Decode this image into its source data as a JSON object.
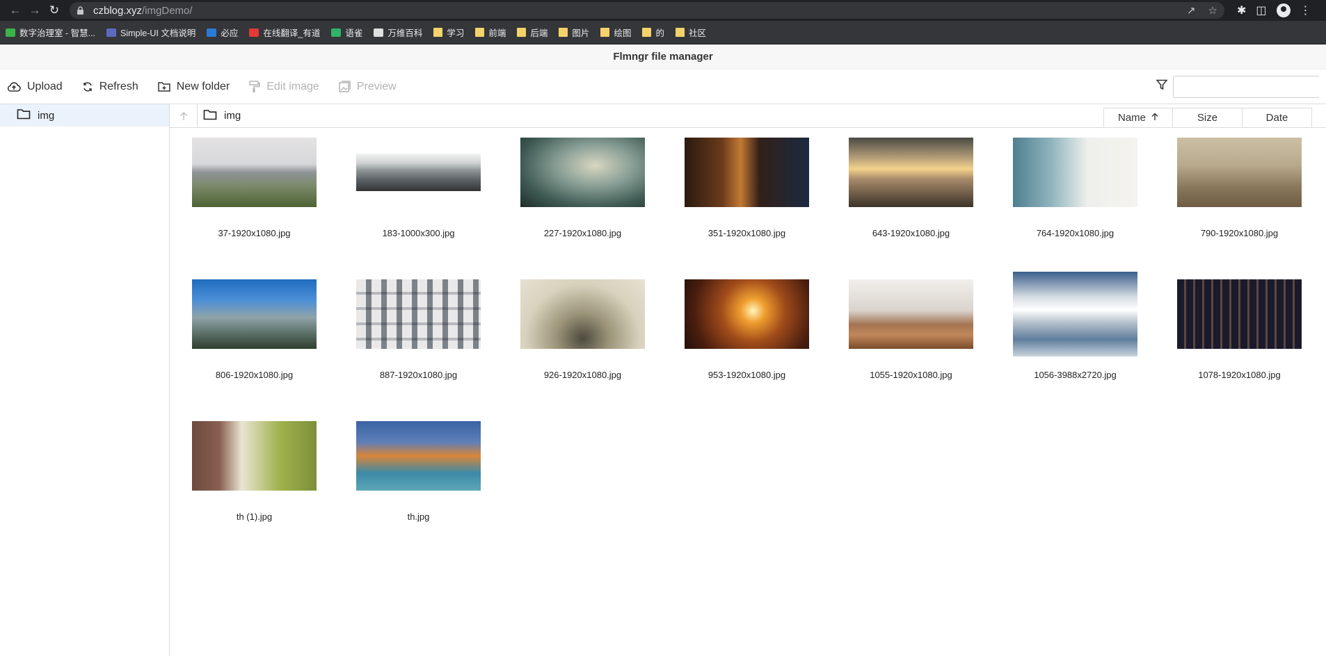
{
  "browser": {
    "url_host": "czblog.xyz",
    "url_path": "/imgDemo/",
    "bookmarks": [
      {
        "label": "数字治理室 - 智慧...",
        "color": "#3bb24a",
        "folder": false
      },
      {
        "label": "Simple-UI 文档说明",
        "color": "#5c6bc0",
        "folder": false
      },
      {
        "label": "必应",
        "color": "#2b7bd6",
        "folder": false
      },
      {
        "label": "在线翻译_有道",
        "color": "#e53935",
        "folder": false
      },
      {
        "label": "语雀",
        "color": "#2fb36a",
        "folder": false
      },
      {
        "label": "万维百科",
        "color": "#e0e0e0",
        "folder": false
      },
      {
        "label": "学习",
        "folder": true
      },
      {
        "label": "前端",
        "folder": true
      },
      {
        "label": "后端",
        "folder": true
      },
      {
        "label": "图片",
        "folder": true
      },
      {
        "label": "绘图",
        "folder": true
      },
      {
        "label": "的",
        "folder": true
      },
      {
        "label": "社区",
        "folder": true
      }
    ]
  },
  "app": {
    "title": "Flmngr file manager",
    "toolbar": {
      "upload": "Upload",
      "refresh": "Refresh",
      "new_folder": "New folder",
      "edit_image": "Edit image",
      "preview": "Preview"
    },
    "search": {
      "placeholder": ""
    },
    "sidebar": {
      "folder": "img"
    },
    "path": {
      "current": "img"
    },
    "sort": {
      "name": "Name",
      "size": "Size",
      "date": "Date"
    },
    "files": [
      {
        "name": "37-1920x1080.jpg",
        "thumb": "t0",
        "shape": "normal"
      },
      {
        "name": "183-1000x300.jpg",
        "thumb": "t1",
        "shape": "wide"
      },
      {
        "name": "227-1920x1080.jpg",
        "thumb": "t2",
        "shape": "normal"
      },
      {
        "name": "351-1920x1080.jpg",
        "thumb": "t3",
        "shape": "normal"
      },
      {
        "name": "643-1920x1080.jpg",
        "thumb": "t4",
        "shape": "normal"
      },
      {
        "name": "764-1920x1080.jpg",
        "thumb": "t5",
        "shape": "normal"
      },
      {
        "name": "790-1920x1080.jpg",
        "thumb": "t6",
        "shape": "normal"
      },
      {
        "name": "806-1920x1080.jpg",
        "thumb": "t7",
        "shape": "normal"
      },
      {
        "name": "887-1920x1080.jpg",
        "thumb": "t8",
        "shape": "normal"
      },
      {
        "name": "926-1920x1080.jpg",
        "thumb": "t9",
        "shape": "normal"
      },
      {
        "name": "953-1920x1080.jpg",
        "thumb": "t10",
        "shape": "normal"
      },
      {
        "name": "1055-1920x1080.jpg",
        "thumb": "t11",
        "shape": "normal"
      },
      {
        "name": "1056-3988x2720.jpg",
        "thumb": "t12",
        "shape": "tall"
      },
      {
        "name": "1078-1920x1080.jpg",
        "thumb": "t13",
        "shape": "normal"
      },
      {
        "name": "th (1).jpg",
        "thumb": "t14",
        "shape": "normal"
      },
      {
        "name": "th.jpg",
        "thumb": "t15",
        "shape": "normal"
      }
    ]
  }
}
